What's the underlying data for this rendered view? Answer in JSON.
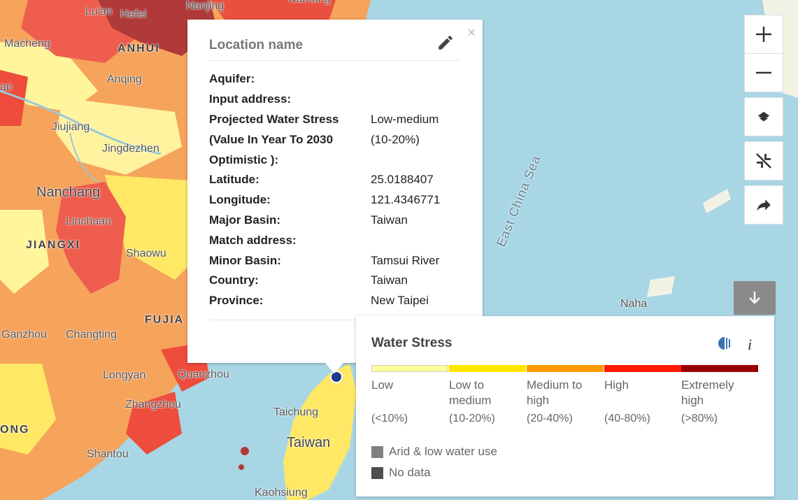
{
  "map": {
    "labels": {
      "luan": "Lu'an",
      "hefei": "Hefei",
      "nanjing": "Nanjing",
      "nantong": "Nantong",
      "macheng": "Macheng",
      "anhui": "ANHUI",
      "anqing": "Anqing",
      "jiujiang": "Jiujiang",
      "jingdezhen": "Jingdezhen",
      "nanchang": "Nanchang",
      "linchuan": "Linchuan",
      "jiangxi": "JIANGXI",
      "shaowu": "Shaowu",
      "fujian": "FUJIA",
      "ganzhou": "Ganzhou",
      "changting": "Changting",
      "longyan": "Longyan",
      "quanzhou": "Quanzhou",
      "zhangzhou": "Zhangzhou",
      "ong": "ONG",
      "shantou": "Shantou",
      "taichung": "Taichung",
      "taiwan": "Taiwan",
      "kaohsiung": "Kaohsiung",
      "naha": "Naha",
      "east_china_sea": "East China Sea",
      "an": "an"
    }
  },
  "popup": {
    "title": "Location name",
    "close": "×",
    "edit_icon": "pencil-icon",
    "rows": [
      {
        "key": "Aquifer:",
        "value": ""
      },
      {
        "key": "Input address:",
        "value": ""
      },
      {
        "key": "Projected Water Stress",
        "value": "Low-medium"
      },
      {
        "key": "(Value In Year To 2030",
        "value": "(10-20%)"
      },
      {
        "key": "Optimistic ):",
        "value": ""
      },
      {
        "key": "Latitude:",
        "value": "25.0188407"
      },
      {
        "key": "Longitude:",
        "value": "121.4346771"
      },
      {
        "key": "Major Basin:",
        "value": "Taiwan"
      },
      {
        "key": "Match address:",
        "value": ""
      },
      {
        "key": "Minor Basin:",
        "value": "Tamsui River"
      },
      {
        "key": "Country:",
        "value": "Taiwan"
      },
      {
        "key": "Province:",
        "value": "New Taipei"
      }
    ]
  },
  "controls": [
    "zoom-in-icon",
    "zoom-out-icon",
    "layers-icon",
    "collapse-icon",
    "share-icon"
  ],
  "legend": {
    "title": "Water Stress",
    "categories": [
      {
        "label": "Low",
        "range": "(<10%)",
        "color": "#ffff99"
      },
      {
        "label": "Low to medium",
        "range": "(10-20%)",
        "color": "#ffe600"
      },
      {
        "label": "Medium to high",
        "range": "(20-40%)",
        "color": "#ff9900"
      },
      {
        "label": "High",
        "range": "(40-80%)",
        "color": "#ff1900"
      },
      {
        "label": "Extremely high",
        "range": "(>80%)",
        "color": "#990000"
      }
    ],
    "extras": [
      {
        "label": "Arid & low water use",
        "color": "#808080"
      },
      {
        "label": "No data",
        "color": "#4e4e4e"
      }
    ],
    "info": "i"
  }
}
